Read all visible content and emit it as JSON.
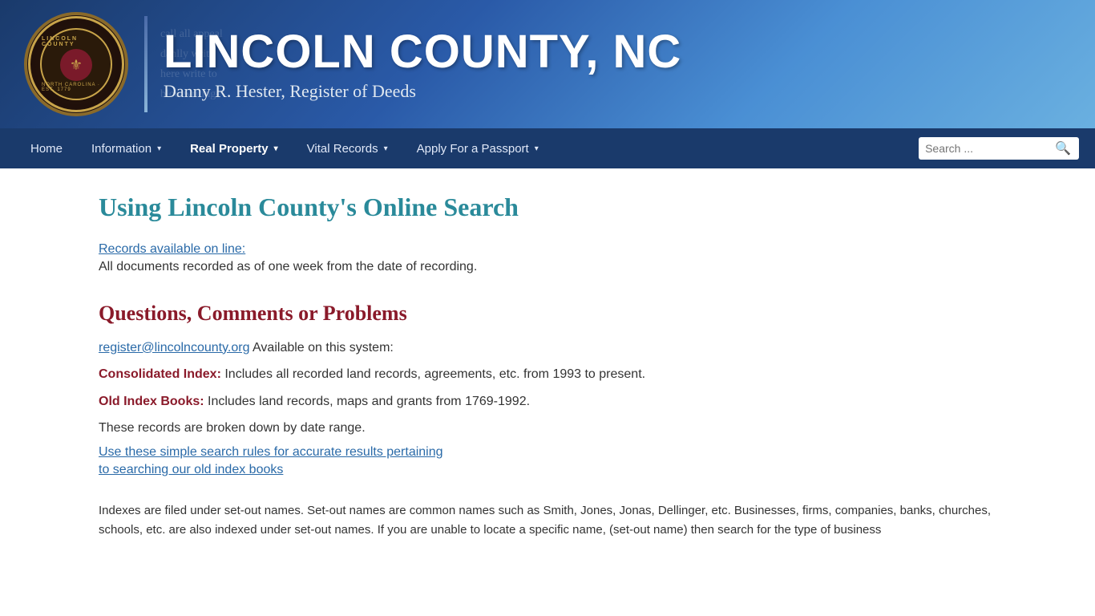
{
  "header": {
    "site_title": "LINCOLN COUNTY, NC",
    "subtitle": "Danny R. Hester, Register of Deeds"
  },
  "nav": {
    "items": [
      {
        "id": "home",
        "label": "Home",
        "has_dropdown": false
      },
      {
        "id": "information",
        "label": "Information",
        "has_dropdown": true
      },
      {
        "id": "real-property",
        "label": "Real Property",
        "has_dropdown": true
      },
      {
        "id": "vital-records",
        "label": "Vital Records",
        "has_dropdown": true
      },
      {
        "id": "apply-passport",
        "label": "Apply For a Passport",
        "has_dropdown": true
      }
    ],
    "search_placeholder": "Search ..."
  },
  "main": {
    "page_title": "Using Lincoln County's Online Search",
    "records_heading": "Records available on line:",
    "records_text": "All documents recorded as of one week from the date of recording.",
    "questions_heading": "Questions, Comments or Problems",
    "contact_email": "register@lincolncounty.org",
    "contact_suffix": " Available on this system:",
    "consolidated_label": "Consolidated Index:",
    "consolidated_text": " Includes all recorded land records, agreements, etc. from 1993 to present.",
    "old_index_label": "Old Index Books:",
    "old_index_text": " Includes land records, maps and grants from 1769-1992.",
    "date_range_text": "These records are broken down by date range.",
    "search_link_1": "Use these simple search rules for accurate results pertaining",
    "search_link_2": "to searching our old index books",
    "bottom_text": "Indexes are filed under set-out names.  Set-out names are common names such as Smith, Jones, Jonas, Dellinger, etc.  Businesses, firms, companies, banks, churches, schools, etc. are also indexed under set-out names.  If you are unable to locate a specific name, (set-out name) then search for the type of business"
  }
}
